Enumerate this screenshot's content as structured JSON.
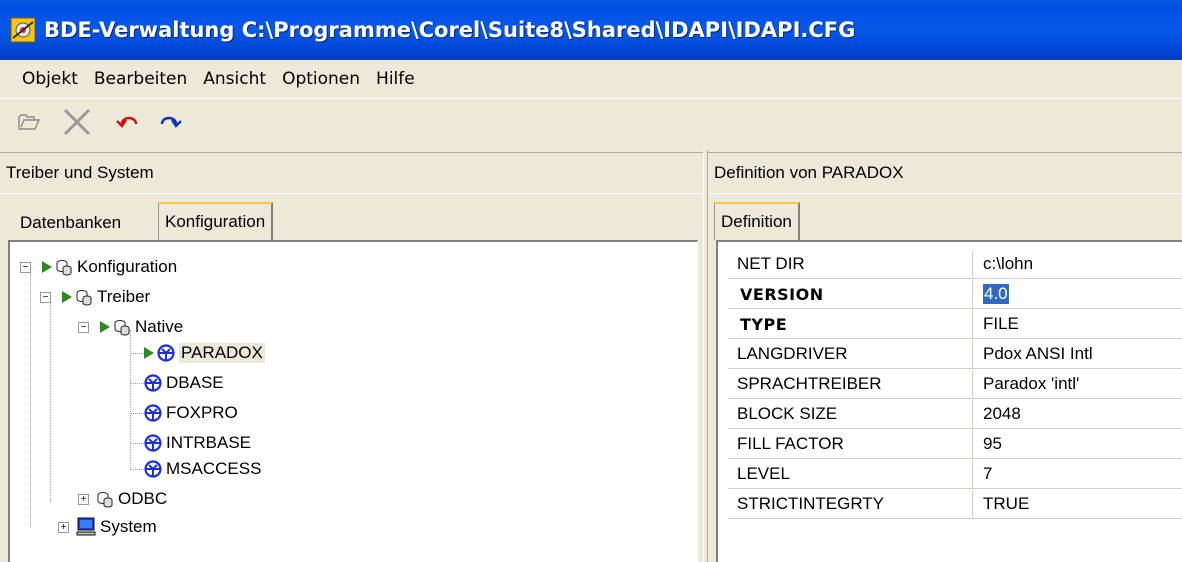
{
  "window": {
    "title": "BDE-Verwaltung  C:\\Programme\\Corel\\Suite8\\Shared\\IDAPI\\IDAPI.CFG"
  },
  "menu": [
    "Objekt",
    "Bearbeiten",
    "Ansicht",
    "Optionen",
    "Hilfe"
  ],
  "toolbar": {
    "icons": [
      "open-folder-icon",
      "delete-x-icon",
      "undo-icon",
      "redo-icon"
    ]
  },
  "left_pane": {
    "header": "Treiber und System",
    "tabs": [
      "Datenbanken",
      "Konfiguration"
    ],
    "active_tab": "Konfiguration",
    "tree": {
      "root": "Konfiguration",
      "treiber": "Treiber",
      "native": "Native",
      "drivers": [
        "PARADOX",
        "DBASE",
        "FOXPRO",
        "INTRBASE",
        "MSACCESS"
      ],
      "selected": "PARADOX",
      "odbc": "ODBC",
      "system": "System"
    }
  },
  "right_pane": {
    "header": "Definition von PARADOX",
    "tab": "Definition",
    "rows": [
      {
        "key": "NET DIR",
        "value": "c:\\lohn",
        "bold": false
      },
      {
        "key": "VERSION",
        "value": "4.0",
        "bold": true
      },
      {
        "key": "TYPE",
        "value": "FILE",
        "bold": true
      },
      {
        "key": "LANGDRIVER",
        "value": "Pdox ANSI Intl",
        "bold": false
      },
      {
        "key": "SPRACHTREIBER",
        "value": "Paradox 'intl'",
        "bold": false
      },
      {
        "key": "BLOCK SIZE",
        "value": "2048",
        "bold": false
      },
      {
        "key": "FILL FACTOR",
        "value": "95",
        "bold": false
      },
      {
        "key": "LEVEL",
        "value": "7",
        "bold": false
      },
      {
        "key": "STRICTINTEGRTY",
        "value": "TRUE",
        "bold": false
      }
    ]
  },
  "colors": {
    "titlebar": "#0054e3",
    "selection": "#316ac5",
    "tree_arrow": "#2a8a1f",
    "driver_icon": "#1c2fd8"
  }
}
